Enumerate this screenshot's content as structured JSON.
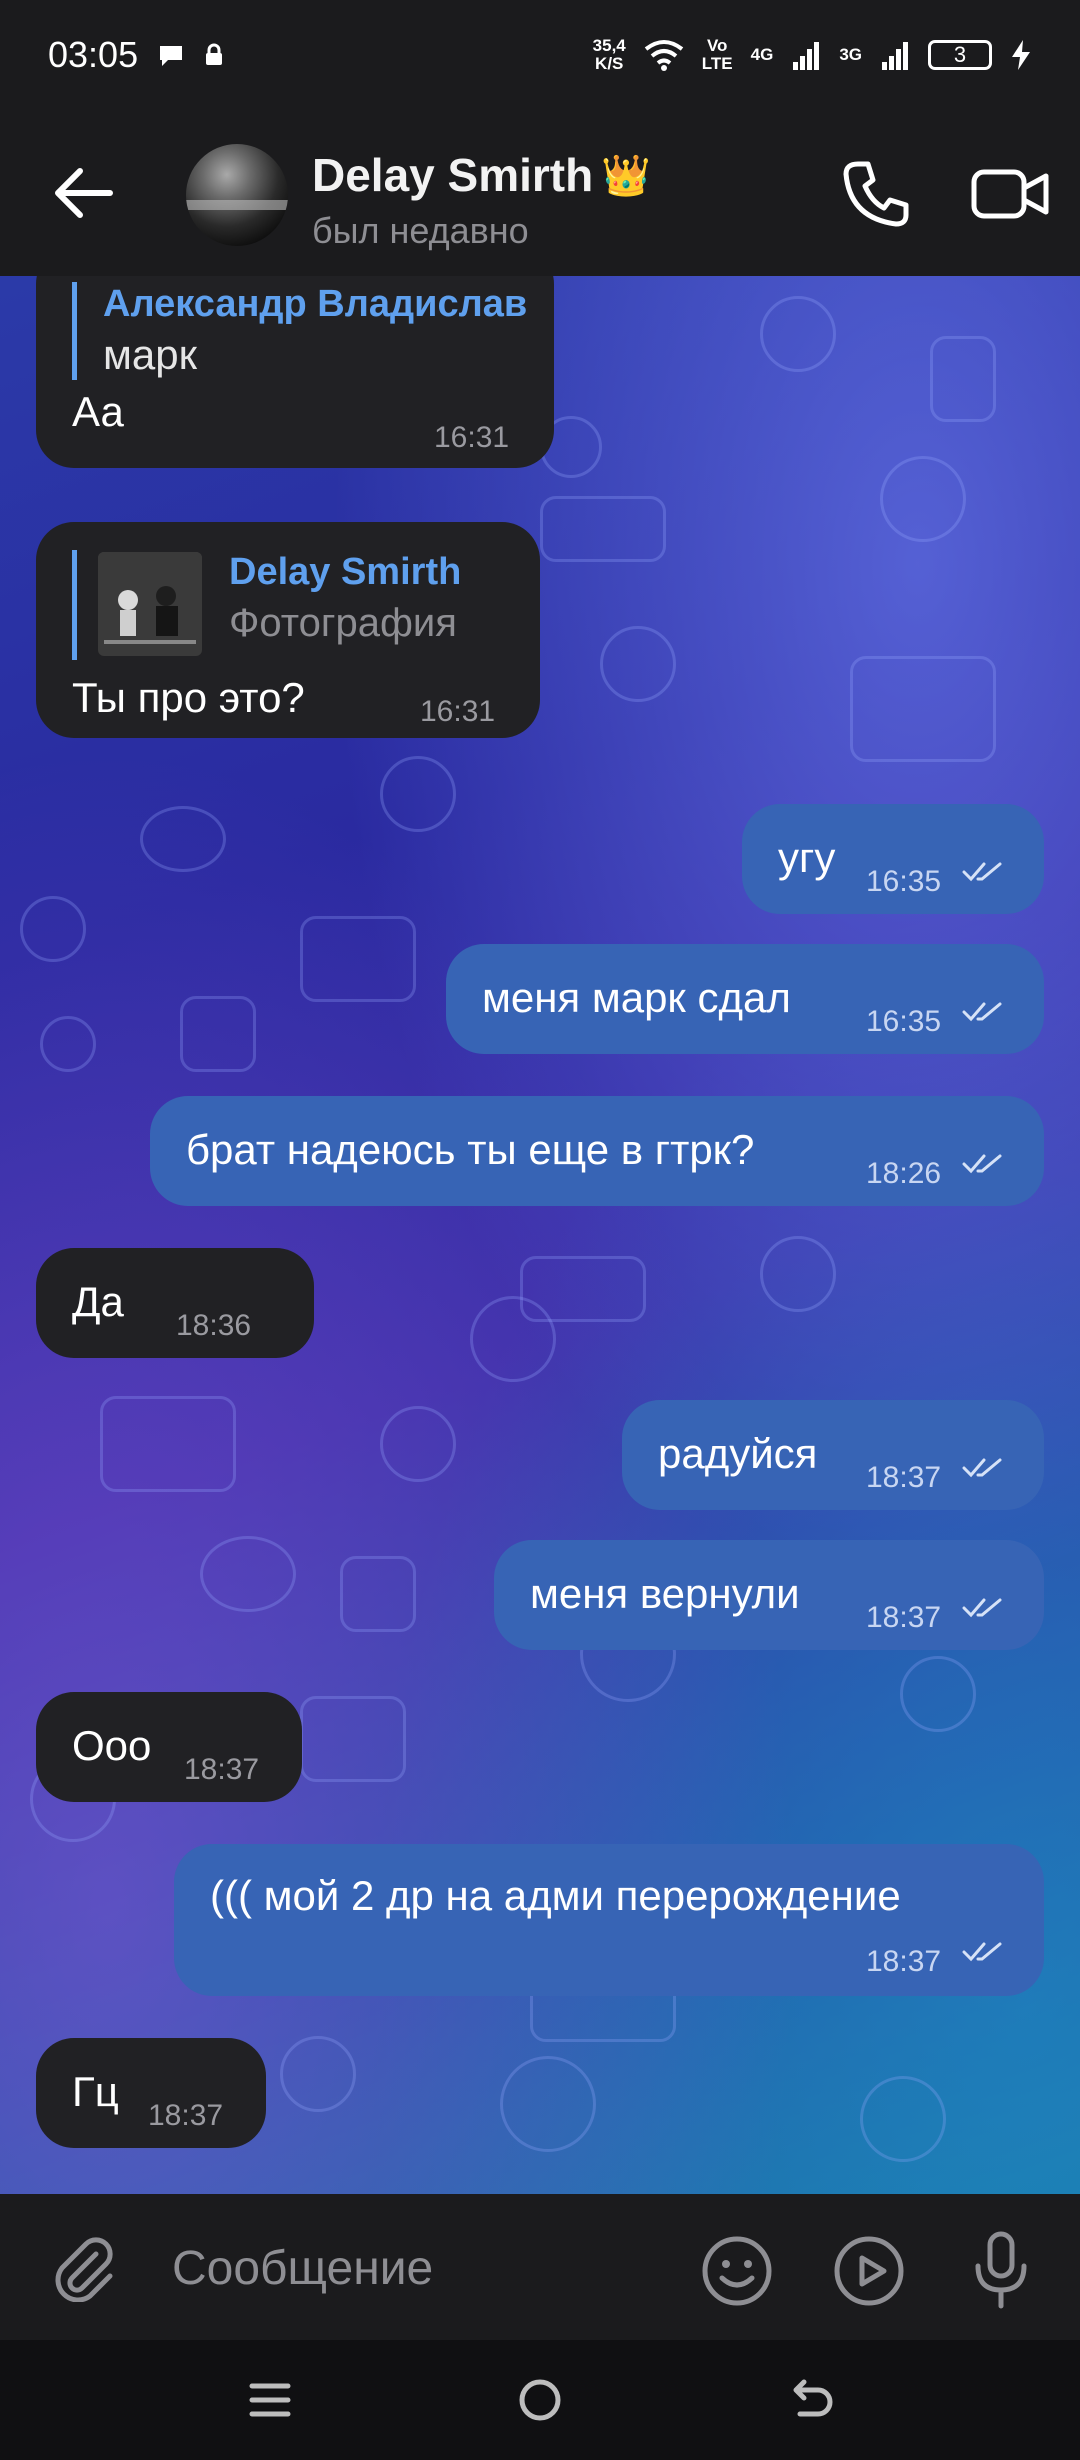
{
  "status_bar": {
    "time": "03:05",
    "speed_value": "35,4",
    "speed_unit": "K/S",
    "volte_top": "Vo",
    "volte_bottom": "LTE",
    "net1": "4G",
    "net2": "3G",
    "battery": "3"
  },
  "header": {
    "contact_name": "Delay Smirth",
    "crown": "👑",
    "last_seen": "был недавно"
  },
  "messages": [
    {
      "reply_name": "Александр Владислав",
      "reply_text": "марк",
      "text": "Аа",
      "time": "16:31"
    },
    {
      "reply_name": "Delay Smirth",
      "reply_text": "Фотография",
      "text": "Ты про это?",
      "time": "16:31"
    },
    {
      "text": "угу",
      "time": "16:35"
    },
    {
      "text": "меня марк сдал",
      "time": "16:35"
    },
    {
      "text": "брат надеюсь ты еще в гтрк?",
      "time": "18:26"
    },
    {
      "text": "Да",
      "time": "18:36"
    },
    {
      "text": "радуйся",
      "time": "18:37"
    },
    {
      "text": "меня вернули",
      "time": "18:37"
    },
    {
      "text": "Ооо",
      "time": "18:37"
    },
    {
      "text": "((( мой 2 др на адми перерождение",
      "time": "18:37"
    },
    {
      "text": "Гц",
      "time": "18:37"
    }
  ],
  "input": {
    "placeholder": "Сообщение"
  },
  "colors": {
    "outgoing_bubble": "#3764b5",
    "incoming_bubble": "#212124",
    "reply_accent": "#5fa0ee"
  },
  "icons": [
    "back-arrow-icon",
    "phone-icon",
    "video-call-icon",
    "attach-icon",
    "emoji-icon",
    "play-icon",
    "microphone-icon",
    "menu-icon",
    "home-icon",
    "back-nav-icon",
    "double-check-icon"
  ]
}
